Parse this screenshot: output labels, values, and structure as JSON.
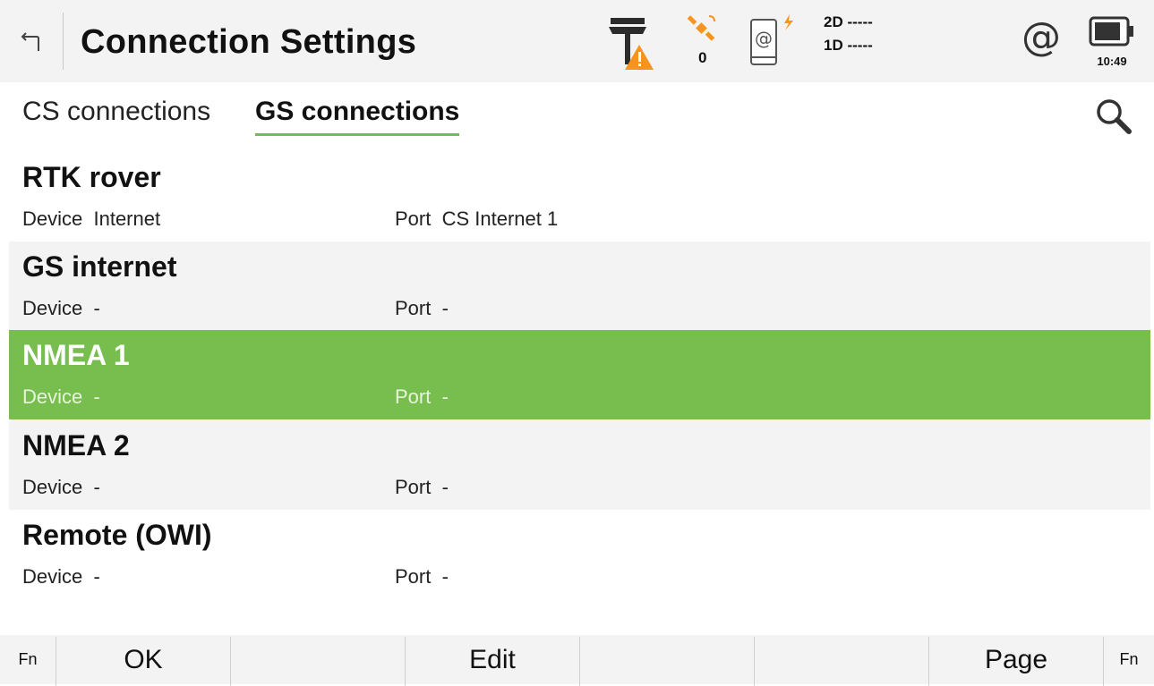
{
  "header": {
    "title": "Connection Settings",
    "back_icon": "back-arrow-icon",
    "satellites": "0",
    "quality_2d": "2D -----",
    "quality_1d": "1D -----",
    "internet_symbol": "@",
    "time": "10:49",
    "warning_color": "#f7941d",
    "satellite_color": "#f7941d"
  },
  "tabs": {
    "cs": "CS connections",
    "gs": "GS connections",
    "active": "gs",
    "accent": "#75bc4f"
  },
  "list": {
    "device_label": "Device",
    "port_label": "Port",
    "selected_color": "#78be4e",
    "items": [
      {
        "name": "RTK rover",
        "device": "Internet",
        "port": "CS Internet 1"
      },
      {
        "name": "GS internet",
        "device": "-",
        "port": "-"
      },
      {
        "name": "NMEA 1",
        "device": "-",
        "port": "-",
        "selected": true
      },
      {
        "name": "NMEA 2",
        "device": "-",
        "port": "-"
      },
      {
        "name": "Remote (OWI)",
        "device": "-",
        "port": "-"
      }
    ]
  },
  "bottom": {
    "fn_left": "Fn",
    "ok": "OK",
    "edit": "Edit",
    "page": "Page",
    "fn_right": "Fn"
  }
}
